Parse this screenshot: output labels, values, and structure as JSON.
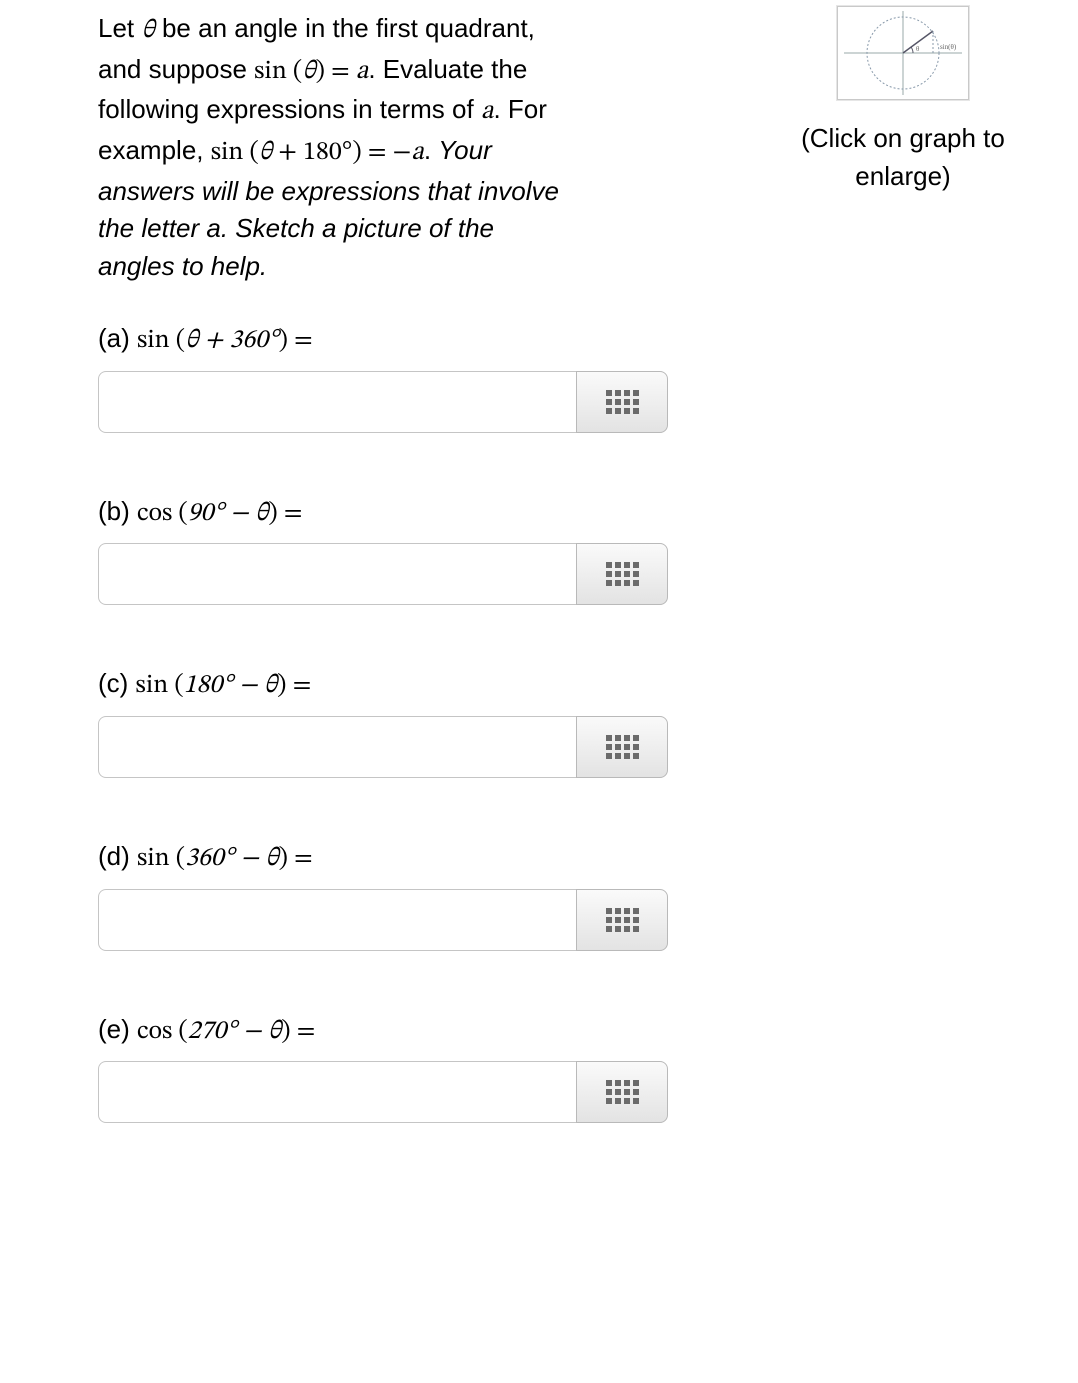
{
  "prompt": {
    "line1_pre": "Let ",
    "theta": "θ",
    "line1_post": " be an angle in the first quadrant,",
    "line2_pre": "and suppose ",
    "sin": "sin",
    "paren_open": " (",
    "paren_close": ") ",
    "equals": "= ",
    "a": "a",
    "line2_post": ". Evaluate the",
    "line3": "following expressions in terms of ",
    "line3_post": ". For",
    "line4_pre": "example, ",
    "plus180": " + 180°",
    "eq_neg_a_pre": "= −",
    "line4_post": ". ",
    "ital1": "Your",
    "ital2": "answers will be expressions that involve",
    "ital3": "the letter a. Sketch a picture of the",
    "ital4": "angles to help."
  },
  "side_caption": "(Click on graph to enlarge)",
  "parts": [
    {
      "id": "a",
      "prefix": "(a) ",
      "fn": "sin",
      "open": " (",
      "inner_pre": "θ + 360°",
      "close": ") =",
      "value": ""
    },
    {
      "id": "b",
      "prefix": "(b) ",
      "fn": "cos",
      "open": " (",
      "inner_pre": "90° − θ",
      "close": ") =",
      "value": ""
    },
    {
      "id": "c",
      "prefix": "(c) ",
      "fn": "sin",
      "open": " (",
      "inner_pre": "180° − θ",
      "close": ") =",
      "value": ""
    },
    {
      "id": "d",
      "prefix": "(d) ",
      "fn": "sin",
      "open": " (",
      "inner_pre": "360° − θ",
      "close": ") =",
      "value": ""
    },
    {
      "id": "e",
      "prefix": "(e) ",
      "fn": "cos",
      "open": " (",
      "inner_pre": "270° − θ",
      "close": ") =",
      "value": ""
    }
  ]
}
